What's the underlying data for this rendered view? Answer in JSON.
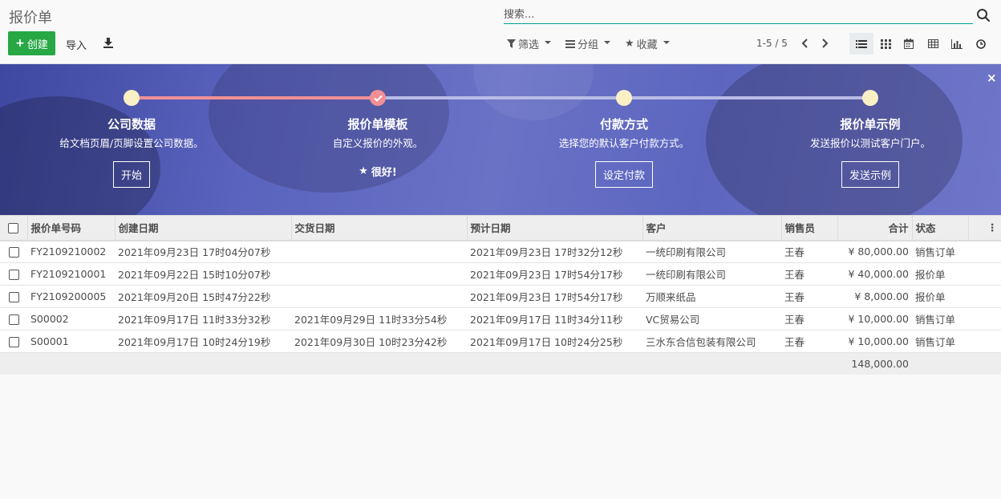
{
  "page": {
    "title": "报价单"
  },
  "search": {
    "placeholder": "搜索..."
  },
  "toolbar": {
    "create_label": "创建",
    "import_label": "导入"
  },
  "filters": {
    "filter_label": "筛选",
    "group_label": "分组",
    "favorites_label": "收藏"
  },
  "pager": {
    "value": "1-5 / 5"
  },
  "onboarding": {
    "steps": [
      {
        "title": "公司数据",
        "description": "给文档页眉/页脚设置公司数据。",
        "button": "开始"
      },
      {
        "title": "报价单模板",
        "description": "自定义报价的外观。",
        "done_label": "很好!"
      },
      {
        "title": "付款方式",
        "description": "选择您的默认客户付款方式。",
        "button": "设定付款"
      },
      {
        "title": "报价单示例",
        "description": "发送报价以测试客户门户。",
        "button": "发送示例"
      }
    ],
    "close_label": "×"
  },
  "table": {
    "columns": [
      "报价单号码",
      "创建日期",
      "交货日期",
      "预计日期",
      "客户",
      "销售员",
      "合计",
      "状态"
    ],
    "rows": [
      {
        "number": "FY2109210002",
        "created": "2021年09月23日 17时04分07秒",
        "delivery": "",
        "expected": "2021年09月23日 17时32分12秒",
        "customer": "一统印刷有限公司",
        "salesperson": "王春",
        "total": "¥ 80,000.00",
        "status": "销售订单"
      },
      {
        "number": "FY2109210001",
        "created": "2021年09月22日 15时10分07秒",
        "delivery": "",
        "expected": "2021年09月23日 17时54分17秒",
        "customer": "一统印刷有限公司",
        "salesperson": "王春",
        "total": "¥ 40,000.00",
        "status": "报价单"
      },
      {
        "number": "FY2109200005",
        "created": "2021年09月20日 15时47分22秒",
        "delivery": "",
        "expected": "2021年09月23日 17时54分17秒",
        "customer": "万顺来纸品",
        "salesperson": "王春",
        "total": "¥ 8,000.00",
        "status": "报价单"
      },
      {
        "number": "S00002",
        "created": "2021年09月17日 11时33分32秒",
        "delivery": "2021年09月29日 11时33分54秒",
        "expected": "2021年09月17日 11时34分11秒",
        "customer": "VC贸易公司",
        "salesperson": "王春",
        "total": "¥ 10,000.00",
        "status": "销售订单"
      },
      {
        "number": "S00001",
        "created": "2021年09月17日 10时24分19秒",
        "delivery": "2021年09月30日 10时23分42秒",
        "expected": "2021年09月17日 10时24分25秒",
        "customer": "三水东合信包装有限公司",
        "salesperson": "王春",
        "total": "¥ 10,000.00",
        "status": "销售订单"
      }
    ],
    "footer_total": "148,000.00"
  },
  "colors": {
    "primary": "#28a745",
    "accent": "#00a09d",
    "banner": "#5a63bd",
    "progress_done": "#f09096",
    "progress_todo": "#b9bde6",
    "dot": "#fbefc6"
  }
}
